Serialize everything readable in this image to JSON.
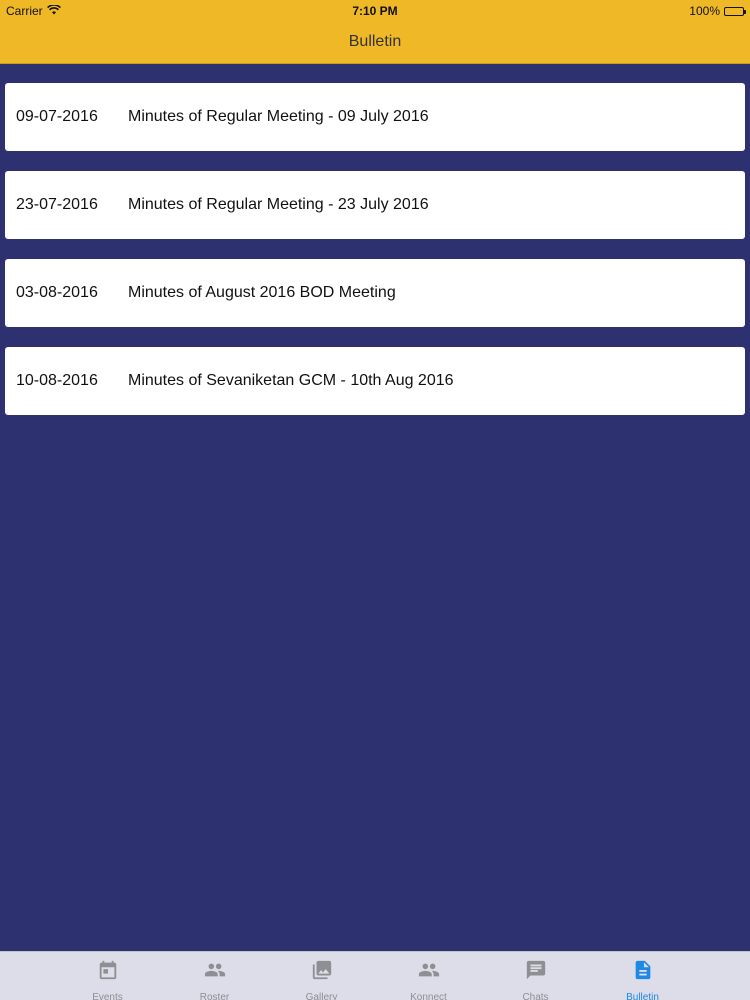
{
  "status_bar": {
    "carrier": "Carrier",
    "time": "7:10 PM",
    "battery": "100%"
  },
  "nav": {
    "title": "Bulletin"
  },
  "bulletins": [
    {
      "date": "09-07-2016",
      "title": "Minutes of Regular Meeting - 09 July 2016"
    },
    {
      "date": "23-07-2016",
      "title": "Minutes of Regular Meeting - 23 July 2016"
    },
    {
      "date": "03-08-2016",
      "title": "Minutes of August 2016 BOD Meeting"
    },
    {
      "date": "10-08-2016",
      "title": "Minutes of Sevaniketan GCM - 10th Aug 2016"
    }
  ],
  "tabs": [
    {
      "label": "Events",
      "icon": "calendar-icon"
    },
    {
      "label": "Roster",
      "icon": "people-icon"
    },
    {
      "label": "Gallery",
      "icon": "image-icon"
    },
    {
      "label": "Konnect",
      "icon": "group-icon"
    },
    {
      "label": "Chats",
      "icon": "chat-icon"
    },
    {
      "label": "Bulletin",
      "icon": "document-icon"
    }
  ],
  "active_tab": "Bulletin",
  "colors": {
    "nav_background": "#efb826",
    "screen_background": "#2d3170",
    "tab_active": "#1e88e5",
    "tab_inactive": "#8e8e93"
  }
}
